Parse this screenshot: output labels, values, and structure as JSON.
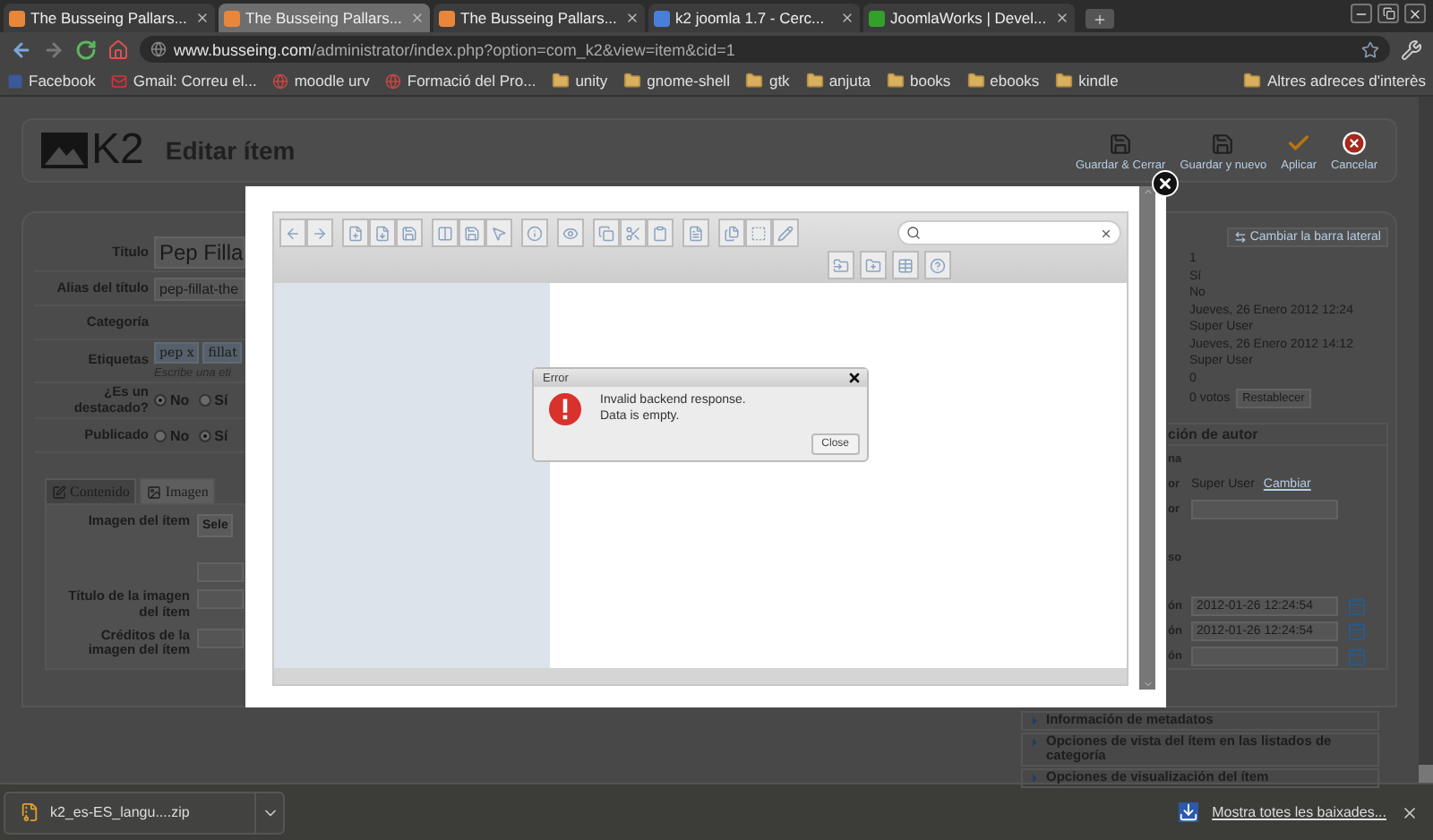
{
  "browser": {
    "tabs": [
      {
        "title": "The Busseing Pallars...",
        "selected": false,
        "kind": "joomla"
      },
      {
        "title": "The Busseing Pallars...",
        "selected": true,
        "kind": "joomla"
      },
      {
        "title": "The Busseing Pallars...",
        "selected": false,
        "kind": "joomla"
      },
      {
        "title": "k2 joomla 1.7 - Cerc...",
        "selected": false,
        "kind": "google"
      },
      {
        "title": "JoomlaWorks | Devel...",
        "selected": false,
        "kind": "works"
      }
    ],
    "address": {
      "host": "www.busseing.com",
      "path": "/administrator/index.php?option=com_k2&view=item&cid=1"
    },
    "bookmarks": [
      {
        "label": "Facebook",
        "kind": "facebook"
      },
      {
        "label": "Gmail: Correu el...",
        "kind": "gmail"
      },
      {
        "label": "moodle urv",
        "kind": "site"
      },
      {
        "label": "Formació del Pro...",
        "kind": "site"
      },
      {
        "label": "unity",
        "kind": "folder"
      },
      {
        "label": "gnome-shell",
        "kind": "folder"
      },
      {
        "label": "gtk",
        "kind": "folder"
      },
      {
        "label": "anjuta",
        "kind": "folder"
      },
      {
        "label": "books",
        "kind": "folder"
      },
      {
        "label": "ebooks",
        "kind": "folder"
      },
      {
        "label": "kindle",
        "kind": "folder"
      }
    ],
    "other_bookmarks": "Altres adreces d'interès"
  },
  "header": {
    "logo": "K2",
    "title": "Editar ítem",
    "actions": [
      {
        "label": "Guardar & Cerrar",
        "kind": "save"
      },
      {
        "label": "Guardar y nuevo",
        "kind": "save"
      },
      {
        "label": "Aplicar",
        "kind": "apply"
      },
      {
        "label": "Cancelar",
        "kind": "cancel"
      }
    ]
  },
  "form": {
    "rows": [
      {
        "label": "Título",
        "kind": "title",
        "value": "Pep Filla"
      },
      {
        "label": "Alias del título",
        "kind": "text",
        "value": "pep-fillat-the"
      },
      {
        "label": "Categoría",
        "kind": "empty"
      },
      {
        "label": "Etiquetas",
        "kind": "tags",
        "tags": [
          {
            "label": "pep",
            "remove": "x"
          },
          {
            "label": "fillat"
          }
        ],
        "hint": "Escribe una eti"
      },
      {
        "label": "¿Es un destacado?",
        "kind": "radio",
        "options": [
          {
            "label": "No",
            "selected": true
          },
          {
            "label": "Sí",
            "selected": false
          }
        ]
      },
      {
        "label": "Publicado",
        "kind": "radio",
        "options": [
          {
            "label": "No",
            "selected": false
          },
          {
            "label": "Sí",
            "selected": true
          }
        ]
      }
    ],
    "tabs": [
      {
        "label": "Contenido",
        "selected": false,
        "kind": "edit"
      },
      {
        "label": "Imagen",
        "selected": true,
        "kind": "image"
      }
    ],
    "image_rows": [
      {
        "label": "Imagen del ítem",
        "button": "Sele"
      },
      {
        "label": "Título de la imagen del ítem"
      },
      {
        "label": "Créditos de la imagen del ítem"
      }
    ]
  },
  "sidebar": {
    "toggle": "Cambiar la barra lateral",
    "values": [
      "1",
      "Sí",
      "No",
      "Jueves, 26 Enero 2012 12:24",
      "Super User",
      "Jueves, 26 Enero 2012 14:12",
      "Super User",
      "0"
    ],
    "votes": "0 votos",
    "reset": "Restablecer",
    "author": {
      "header": "ción de autor",
      "rows": [
        {
          "label": "na",
          "kind": "blank"
        },
        {
          "label": "or",
          "kind": "user",
          "value": "Super User",
          "link": "Cambiar"
        },
        {
          "label": "or",
          "kind": "input"
        },
        {
          "label": "so",
          "kind": "blank"
        },
        {
          "label": "ón",
          "kind": "date",
          "value": "2012-01-26 12:24:54"
        },
        {
          "label": "ón",
          "kind": "date",
          "value": "2012-01-26 12:24:54"
        },
        {
          "label": "ón",
          "kind": "date"
        }
      ]
    }
  },
  "sections": [
    "Información de metadatos",
    "Opciones de vista del ítem en las listados de categoría",
    "Opciones de visualización del ítem"
  ],
  "modal": {
    "error": {
      "title": "Error",
      "lines": [
        "Invalid backend response.",
        "Data is empty."
      ],
      "button": "Close"
    }
  },
  "downloads": {
    "file": "k2_es-ES_langu....zip",
    "show_all": "Mostra totes les baixades..."
  }
}
